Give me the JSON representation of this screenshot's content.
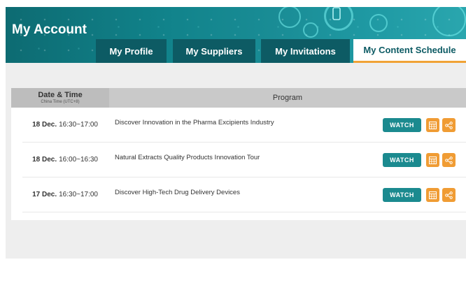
{
  "header": {
    "title": "My Account"
  },
  "tabs": [
    {
      "label": "My Profile",
      "active": false
    },
    {
      "label": "My Suppliers",
      "active": false
    },
    {
      "label": "My Invitations",
      "active": false
    },
    {
      "label": "My Content Schedule",
      "active": true
    }
  ],
  "table": {
    "columns": {
      "date_time": "Date & Time",
      "timezone": "China Time (UTC+8)",
      "program": "Program"
    },
    "rows": [
      {
        "day": "18 Dec.",
        "time": "16:30~17:00",
        "title": "Discover Innovation in the Pharma Excipients Industry",
        "watch_label": "WATCH"
      },
      {
        "day": "18 Dec.",
        "time": "16:00~16:30",
        "title": "Natural Extracts Quality Products Innovation Tour",
        "watch_label": "WATCH"
      },
      {
        "day": "17 Dec.",
        "time": "16:30~17:00",
        "title": "Discover High-Tech Drug Delivery Devices",
        "watch_label": "WATCH"
      }
    ],
    "row_icons": [
      "calendar-icon",
      "share-icon"
    ]
  },
  "colors": {
    "header_teal": "#11838b",
    "tab_dark": "#0d5b64",
    "accent_orange": "#f09c34",
    "watch_teal": "#1b8a8f"
  }
}
